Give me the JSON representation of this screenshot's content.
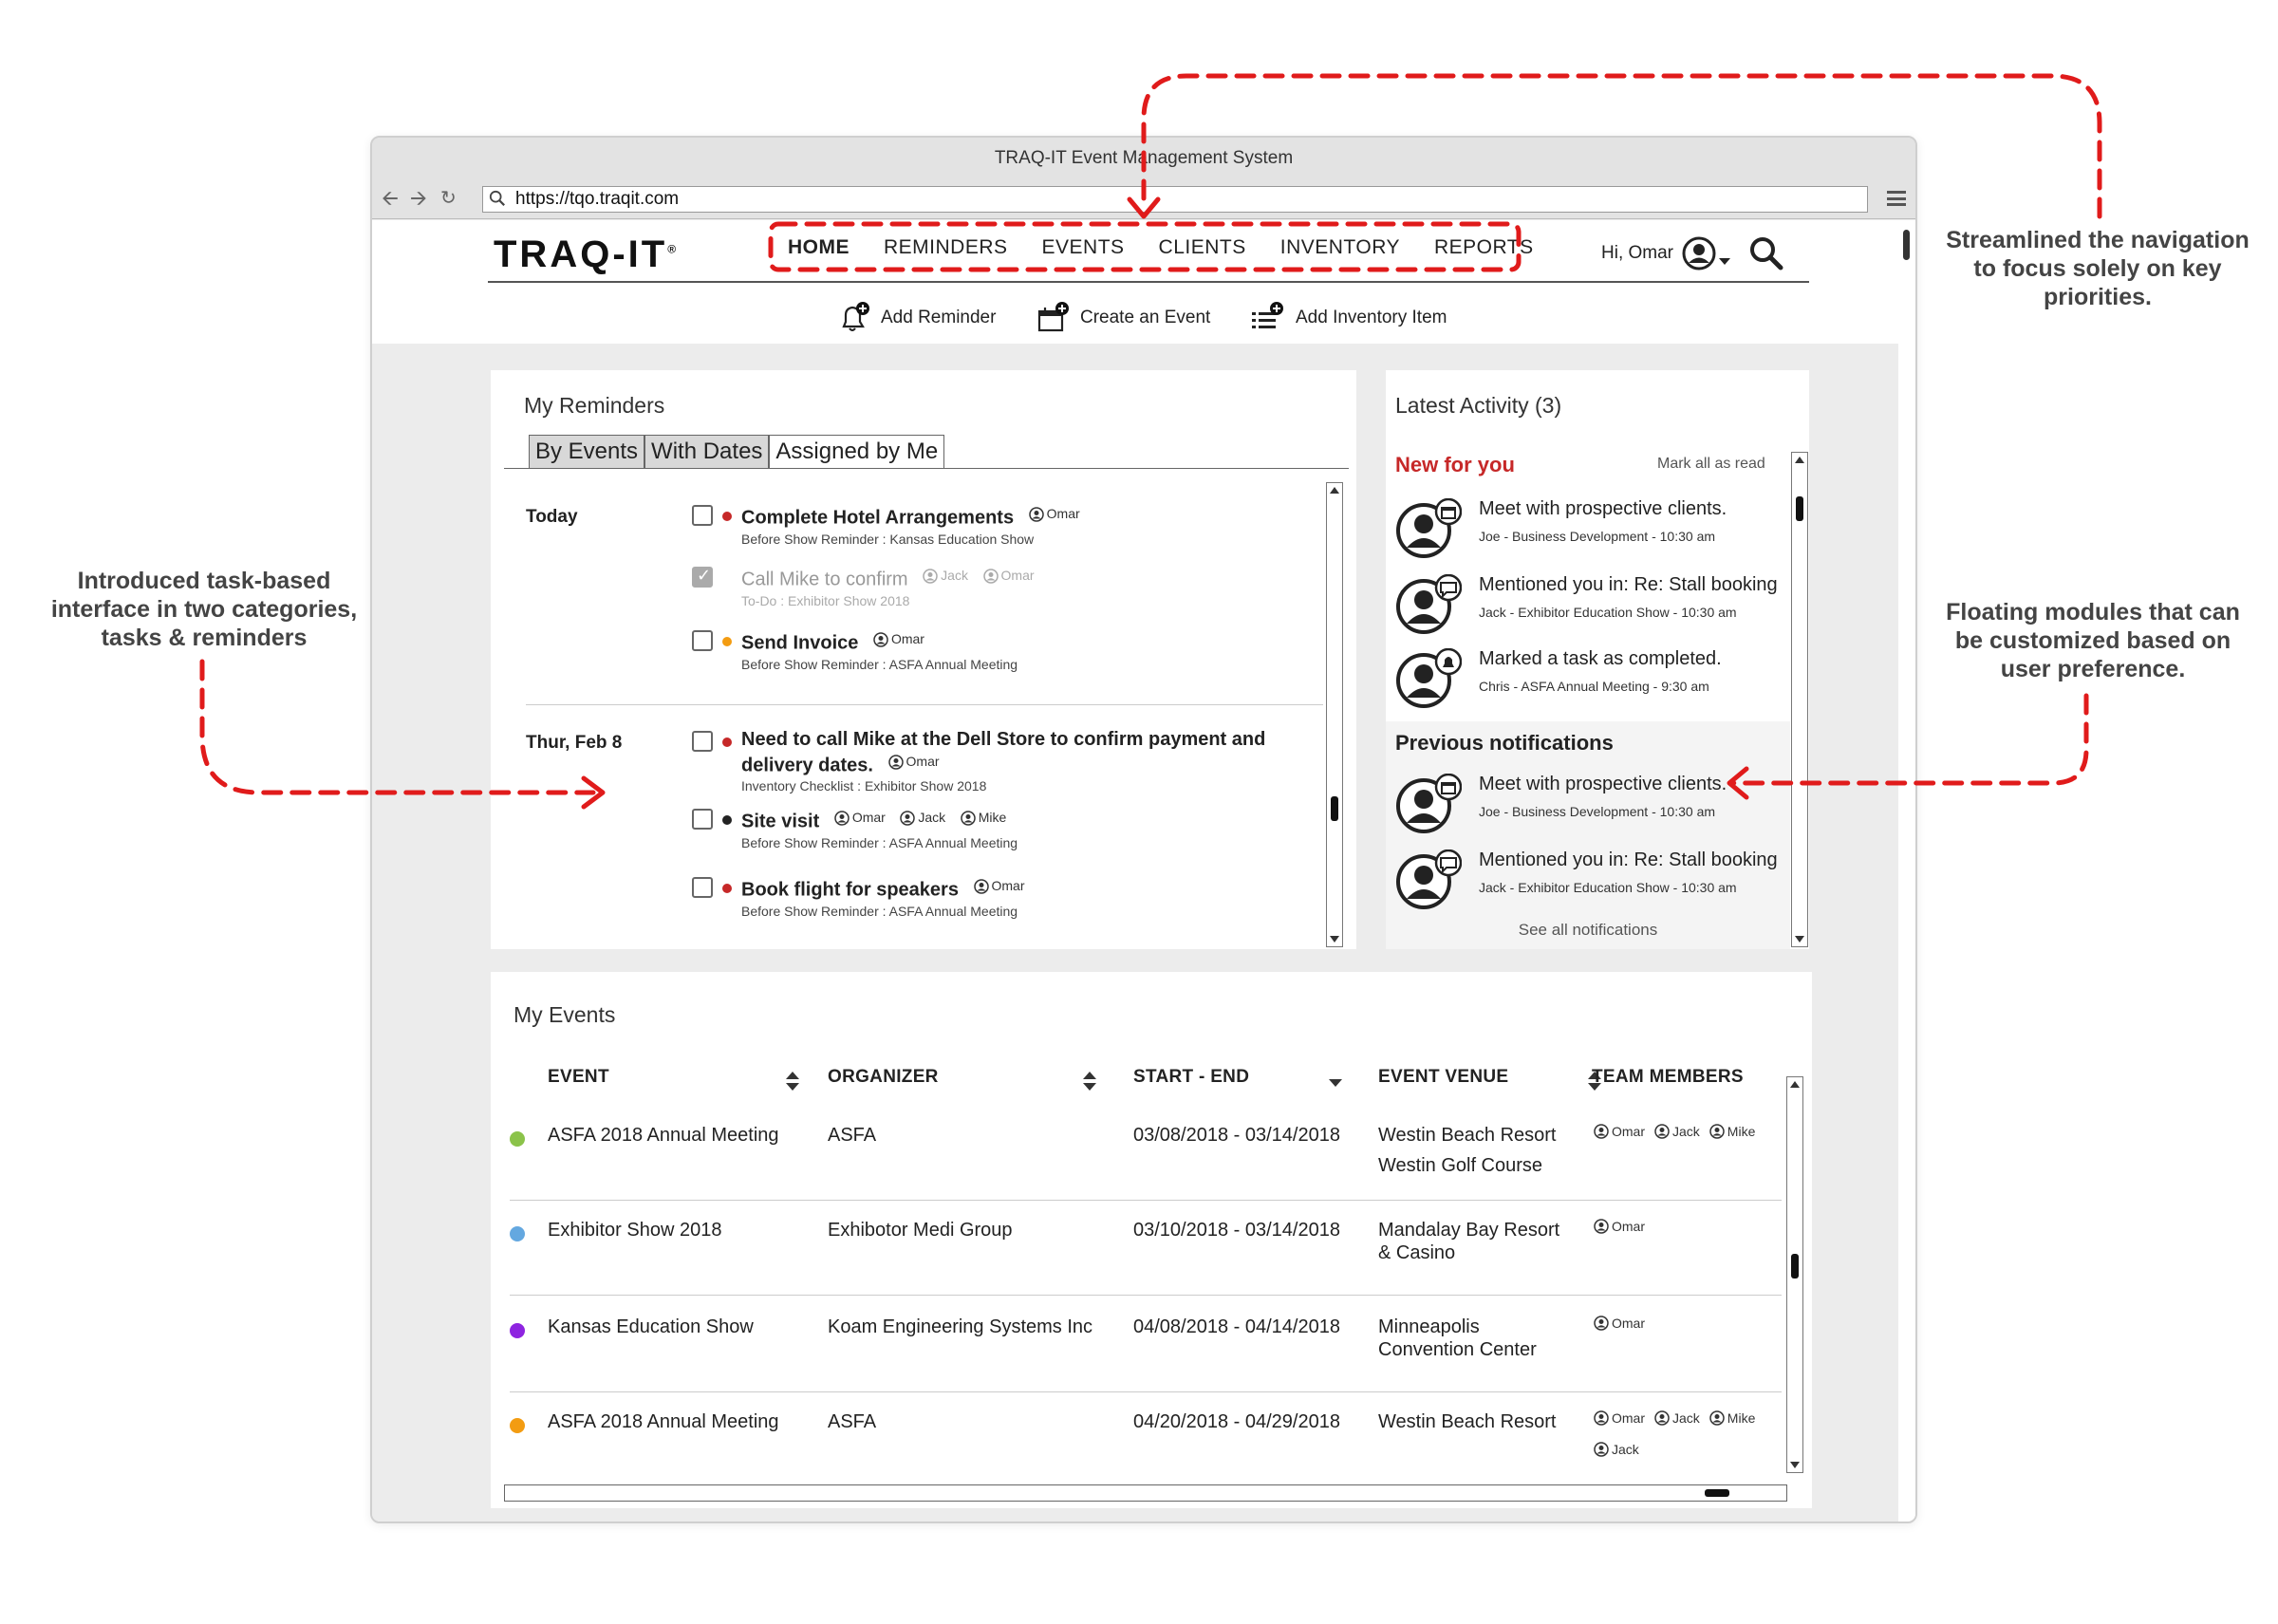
{
  "browser": {
    "window_title": "TRAQ-IT Event Management System",
    "url": "https://tqo.traqit.com"
  },
  "header": {
    "logo": "TRAQ-IT",
    "logo_mark": "®",
    "nav": [
      "HOME",
      "REMINDERS",
      "EVENTS",
      "CLIENTS",
      "INVENTORY",
      "REPORTS"
    ],
    "active_nav": "HOME",
    "greeting": "Hi, Omar",
    "quick_actions": {
      "add_reminder": "Add Reminder",
      "create_event": "Create an Event",
      "add_inventory": "Add Inventory Item"
    }
  },
  "reminders": {
    "title": "My Reminders",
    "tabs": [
      "By Events",
      "With Dates",
      "Assigned by Me"
    ],
    "active_tab": "Assigned by Me",
    "groups": [
      {
        "day": "Today",
        "tasks": [
          {
            "title": "Complete Hotel Arrangements",
            "people": [
              "Omar"
            ],
            "sub": "Before Show Reminder : Kansas Education Show",
            "dot": "#c62828",
            "checked": false
          },
          {
            "title": "Call Mike to confirm",
            "people": [
              "Jack",
              "Omar"
            ],
            "sub": "To-Do : Exhibitor Show 2018",
            "dot": "",
            "checked": true
          },
          {
            "title": "Send Invoice",
            "people": [
              "Omar"
            ],
            "sub": "Before Show Reminder : ASFA Annual Meeting",
            "dot": "#f39c12",
            "checked": false
          }
        ]
      },
      {
        "day": "Thur, Feb 8",
        "tasks": [
          {
            "title": "Need to call Mike at the Dell Store to confirm payment and",
            "title2": "delivery dates.",
            "people": [
              "Omar"
            ],
            "sub": "Inventory Checklist  : Exhibitor Show 2018",
            "dot": "#c62828",
            "checked": false
          },
          {
            "title": "Site visit",
            "people": [
              "Omar",
              "Jack",
              "Mike"
            ],
            "sub": "Before Show Reminder : ASFA Annual Meeting",
            "dot": "#222222",
            "checked": false
          },
          {
            "title": "Book flight for speakers",
            "people": [
              "Omar"
            ],
            "sub": "Before Show Reminder : ASFA Annual Meeting",
            "dot": "#c62828",
            "checked": false
          }
        ]
      }
    ]
  },
  "activity": {
    "title": "Latest Activity (3)",
    "new_label": "New for you",
    "mark_all": "Mark all as read",
    "new_items": [
      {
        "msg": "Meet with prospective clients.",
        "meta": "Joe - Business Development - 10:30 am",
        "badge": "calendar"
      },
      {
        "msg": "Mentioned you in: Re: Stall booking",
        "meta": "Jack - Exhibitor Education Show - 10:30 am",
        "badge": "chat"
      },
      {
        "msg": "Marked a task as completed.",
        "meta": "Chris - ASFA Annual Meeting - 9:30 am",
        "badge": "bell"
      }
    ],
    "previous_label": "Previous notifications",
    "previous_items": [
      {
        "msg": "Meet with prospective clients.",
        "meta": "Joe - Business Development - 10:30 am",
        "badge": "calendar"
      },
      {
        "msg": "Mentioned you in: Re: Stall booking",
        "meta": "Jack - Exhibitor Education Show - 10:30 am",
        "badge": "chat"
      }
    ],
    "see_all": "See all notifications"
  },
  "events": {
    "title": "My Events",
    "columns": [
      "EVENT",
      "ORGANIZER",
      "START - END",
      "EVENT VENUE",
      "TEAM MEMBERS"
    ],
    "rows": [
      {
        "event": "ASFA 2018 Annual Meeting",
        "organizer": "ASFA",
        "dates": "03/08/2018 - 03/14/2018",
        "venue1": "Westin Beach Resort",
        "venue2": "Westin Golf Course",
        "members": [
          "Omar",
          "Jack",
          "Mike"
        ],
        "members2": [],
        "color": "#8bc34a"
      },
      {
        "event": "Exhibitor Show 2018",
        "organizer": "Exhibotor Medi Group",
        "dates": "03/10/2018 - 03/14/2018",
        "venue1": "Mandalay Bay Resort",
        "venue2": "& Casino",
        "members": [
          "Omar"
        ],
        "members2": [],
        "color": "#64a8e0"
      },
      {
        "event": "Kansas Education Show",
        "organizer": "Koam Engineering Systems Inc",
        "dates": "04/08/2018 - 04/14/2018",
        "venue1": "Minneapolis",
        "venue2": "Convention Center",
        "members": [
          "Omar"
        ],
        "members2": [],
        "color": "#8e24e0"
      },
      {
        "event": "ASFA 2018 Annual Meeting",
        "organizer": "ASFA",
        "dates": "04/20/2018 - 04/29/2018",
        "venue1": "Westin Beach Resort",
        "venue2": "",
        "members": [
          "Omar",
          "Jack",
          "Mike"
        ],
        "members2": [
          "Jack"
        ],
        "color": "#f39c12"
      }
    ]
  },
  "annotations": {
    "nav_note": [
      "Streamlined the navigation",
      "to focus solely on key",
      "priorities."
    ],
    "tasks_note": [
      "Introduced task-based",
      "interface in two categories,",
      "tasks & reminders"
    ],
    "modules_note": [
      "Floating modules that can",
      "be customized based on",
      "user preference."
    ]
  },
  "colors": {
    "annotation_red": "#e01b1b",
    "new_for_you": "#c62828"
  }
}
